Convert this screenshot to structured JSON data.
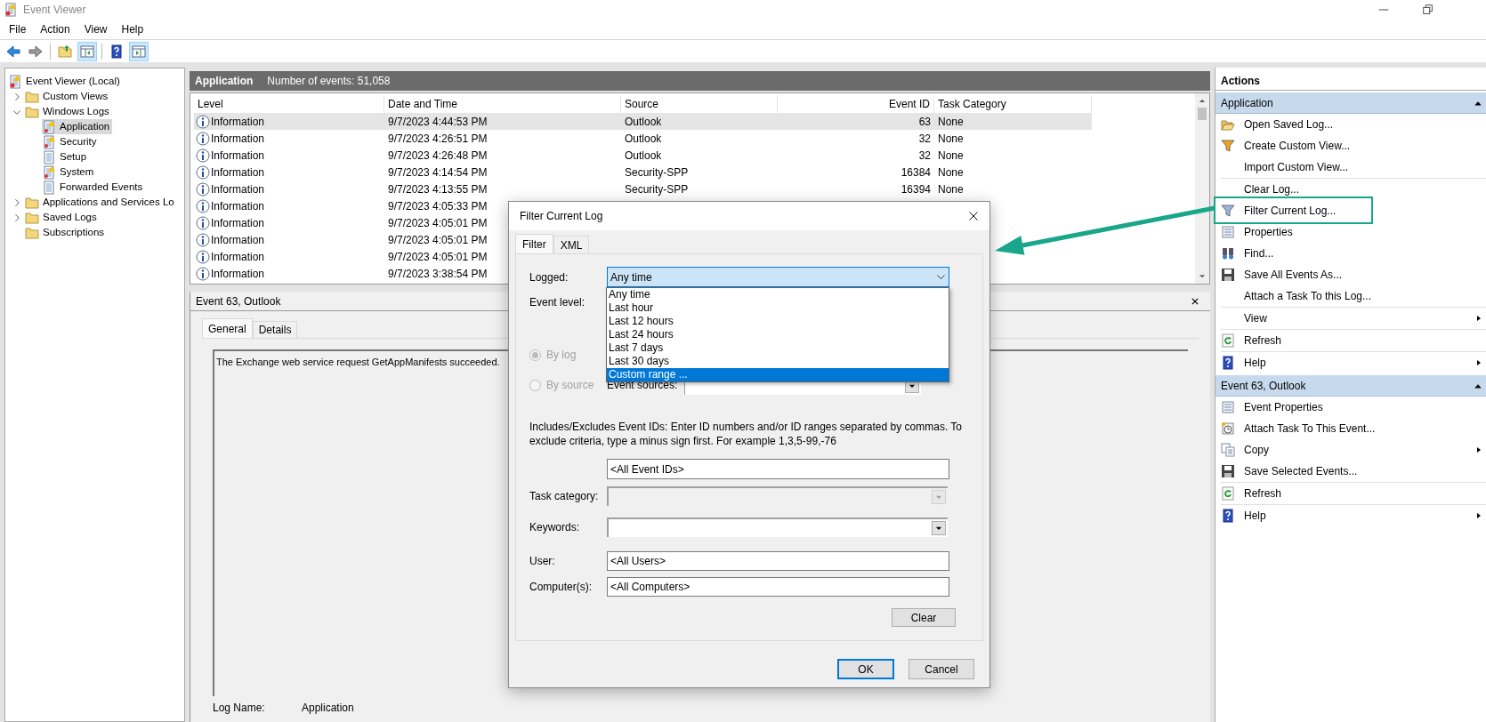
{
  "window": {
    "title": "Event Viewer"
  },
  "menu": [
    "File",
    "Action",
    "View",
    "Help"
  ],
  "toolbar": [
    {
      "kind": "back",
      "pressed": false
    },
    {
      "kind": "forward",
      "pressed": false
    },
    {
      "kind": "separator"
    },
    {
      "kind": "up",
      "pressed": false
    },
    {
      "kind": "tree_pane",
      "pressed": true
    },
    {
      "kind": "separator"
    },
    {
      "kind": "help",
      "pressed": false
    },
    {
      "kind": "action_pane",
      "pressed": true
    }
  ],
  "tree": [
    {
      "label": "Event Viewer (Local)",
      "kind": "viewer",
      "selected": false,
      "children": [
        {
          "label": "Custom Views",
          "kind": "folder",
          "selected": false,
          "expanded": false
        },
        {
          "label": "Windows Logs",
          "kind": "folder",
          "selected": false,
          "expanded": true,
          "children": [
            {
              "label": "Application",
              "kind": "alert_log",
              "selected": true
            },
            {
              "label": "Security",
              "kind": "alert_log",
              "selected": false
            },
            {
              "label": "Setup",
              "kind": "log",
              "selected": false
            },
            {
              "label": "System",
              "kind": "alert_log",
              "selected": false
            },
            {
              "label": "Forwarded Events",
              "kind": "log",
              "selected": false
            }
          ]
        },
        {
          "label": "Applications and Services Lo",
          "kind": "folder",
          "selected": false,
          "expanded": false
        },
        {
          "label": "Saved Logs",
          "kind": "folder",
          "selected": false,
          "expanded": false
        },
        {
          "label": "Subscriptions",
          "kind": "folder",
          "selected": false
        }
      ]
    }
  ],
  "pane_header": {
    "title": "Application",
    "subtitle": "Number of events: 51,058"
  },
  "table": {
    "columns": [
      "Level",
      "Date and Time",
      "Source",
      "Event ID",
      "Task Category"
    ],
    "rows": [
      {
        "selected": true,
        "cells": [
          "Information",
          "9/7/2023 4:44:53 PM",
          "Outlook",
          "63",
          "None"
        ]
      },
      {
        "selected": false,
        "cells": [
          "Information",
          "9/7/2023 4:26:51 PM",
          "Outlook",
          "32",
          "None"
        ]
      },
      {
        "selected": false,
        "cells": [
          "Information",
          "9/7/2023 4:26:48 PM",
          "Outlook",
          "32",
          "None"
        ]
      },
      {
        "selected": false,
        "cells": [
          "Information",
          "9/7/2023 4:14:54 PM",
          "Security-SPP",
          "16384",
          "None"
        ]
      },
      {
        "selected": false,
        "cells": [
          "Information",
          "9/7/2023 4:13:55 PM",
          "Security-SPP",
          "16394",
          "None"
        ]
      },
      {
        "selected": false,
        "cells": [
          "Information",
          "9/7/2023 4:05:33 PM"
        ]
      },
      {
        "selected": false,
        "cells": [
          "Information",
          "9/7/2023 4:05:01 PM"
        ]
      },
      {
        "selected": false,
        "cells": [
          "Information",
          "9/7/2023 4:05:01 PM"
        ]
      },
      {
        "selected": false,
        "cells": [
          "Information",
          "9/7/2023 4:05:01 PM"
        ]
      },
      {
        "selected": false,
        "cells": [
          "Information",
          "9/7/2023 3:38:54 PM"
        ]
      }
    ]
  },
  "event_pane": {
    "title": "Event 63, Outlook",
    "tabs": [
      {
        "label": "General",
        "selected": true
      },
      {
        "label": "Details",
        "selected": false
      }
    ],
    "description": "The Exchange web service request GetAppManifests succeeded.",
    "fields": [
      {
        "label": "Log Name:",
        "value": "Application"
      }
    ]
  },
  "actions": {
    "title": "Actions",
    "sections": [
      {
        "title": "Application",
        "expanded": true,
        "items": [
          {
            "kind": "open",
            "label": "Open Saved Log..."
          },
          {
            "kind": "new_filter",
            "label": "Create Custom View..."
          },
          {
            "kind": "plain",
            "label": "Import Custom View..."
          },
          {
            "kind": "separator"
          },
          {
            "kind": "plain",
            "label": "Clear Log..."
          },
          {
            "kind": "filter",
            "label": "Filter Current Log..."
          },
          {
            "kind": "properties",
            "label": "Properties"
          },
          {
            "kind": "find",
            "label": "Find..."
          },
          {
            "kind": "save",
            "label": "Save All Events As..."
          },
          {
            "kind": "plain",
            "label": "Attach a Task To this Log..."
          },
          {
            "kind": "separator"
          },
          {
            "kind": "plain",
            "label": "View",
            "submenu": true
          },
          {
            "kind": "separator"
          },
          {
            "kind": "refresh",
            "label": "Refresh"
          },
          {
            "kind": "separator"
          },
          {
            "kind": "help",
            "label": "Help",
            "submenu": true
          }
        ]
      },
      {
        "title": "Event 63, Outlook",
        "expanded": true,
        "items": [
          {
            "kind": "properties",
            "label": "Event Properties"
          },
          {
            "kind": "attach",
            "label": "Attach Task To This Event..."
          },
          {
            "kind": "copy",
            "label": "Copy",
            "submenu": true
          },
          {
            "kind": "save",
            "label": "Save Selected Events..."
          },
          {
            "kind": "separator"
          },
          {
            "kind": "refresh",
            "label": "Refresh"
          },
          {
            "kind": "separator"
          },
          {
            "kind": "help",
            "label": "Help",
            "submenu": true
          }
        ]
      }
    ]
  },
  "dialog": {
    "title": "Filter Current Log",
    "tabs": [
      {
        "label": "Filter",
        "selected": true
      },
      {
        "label": "XML",
        "selected": false
      }
    ],
    "logged": {
      "label": "Logged:",
      "value": "Any time",
      "open": true,
      "options": [
        {
          "label": "Any time",
          "highlighted": false
        },
        {
          "label": "Last hour",
          "highlighted": false
        },
        {
          "label": "Last 12 hours",
          "highlighted": false
        },
        {
          "label": "Last 24 hours",
          "highlighted": false
        },
        {
          "label": "Last 7 days",
          "highlighted": false
        },
        {
          "label": "Last 30 days",
          "highlighted": false
        },
        {
          "label": "Custom range ...",
          "highlighted": true
        }
      ]
    },
    "event_level": {
      "label": "Event level:"
    },
    "scope": [
      {
        "label": "By log",
        "checked": true,
        "disabled": true
      },
      {
        "label": "By source",
        "checked": false,
        "disabled": true
      }
    ],
    "event_sources": {
      "label": "Event sources:"
    },
    "help_text": "Includes/Excludes Event IDs: Enter ID numbers and/or ID ranges separated by commas. To exclude criteria, type a minus sign first. For example 1,3,5-99,-76",
    "event_ids": {
      "value": "<All Event IDs>"
    },
    "task_category": {
      "label": "Task category:",
      "disabled": true
    },
    "keywords": {
      "label": "Keywords:",
      "disabled": false
    },
    "user": {
      "label": "User:",
      "value": "<All Users>"
    },
    "computers": {
      "label": "Computer(s):",
      "value": "<All Computers>"
    },
    "clear_button": "Clear",
    "buttons": [
      {
        "label": "OK",
        "default": true
      },
      {
        "label": "Cancel",
        "default": false
      }
    ]
  }
}
